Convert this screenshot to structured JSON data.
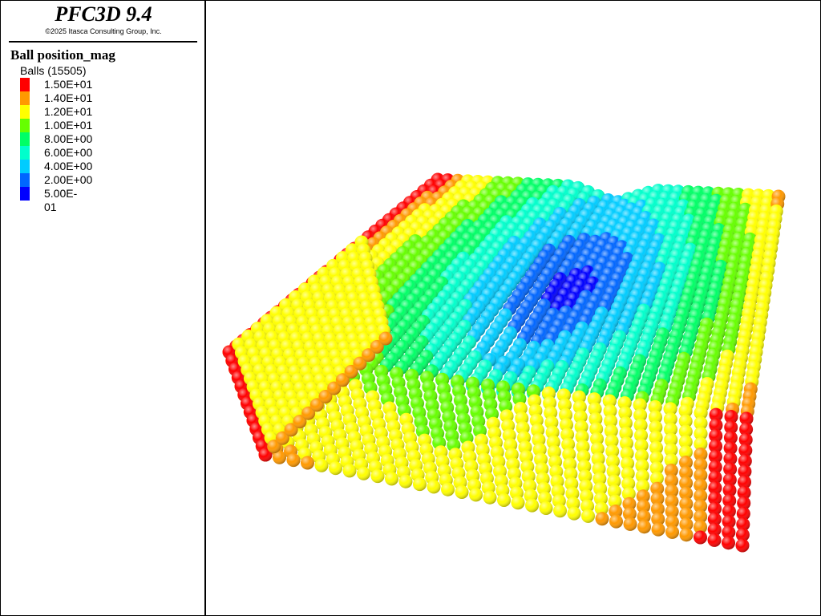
{
  "app": {
    "title": "PFC3D 9.4",
    "copyright": "©2025 Itasca Consulting Group, Inc."
  },
  "legend": {
    "title": "Ball position_mag",
    "subtitle": "Balls (15505)",
    "items": [
      {
        "label": "1.50E+01",
        "color": "#ff0000"
      },
      {
        "label": "1.40E+01",
        "color": "#ff9900"
      },
      {
        "label": "1.20E+01",
        "color": "#ffff00"
      },
      {
        "label": "1.00E+01",
        "color": "#66ff00"
      },
      {
        "label": "8.00E+00",
        "color": "#00ff66"
      },
      {
        "label": "6.00E+00",
        "color": "#00ffcc"
      },
      {
        "label": "4.00E+00",
        "color": "#00ccff"
      },
      {
        "label": "2.00E+00",
        "color": "#0066ff"
      },
      {
        "label": "5.00E-01",
        "color": "#0000ff"
      }
    ]
  },
  "viewport": {
    "scene": "3D ball assembly colored by position magnitude"
  }
}
